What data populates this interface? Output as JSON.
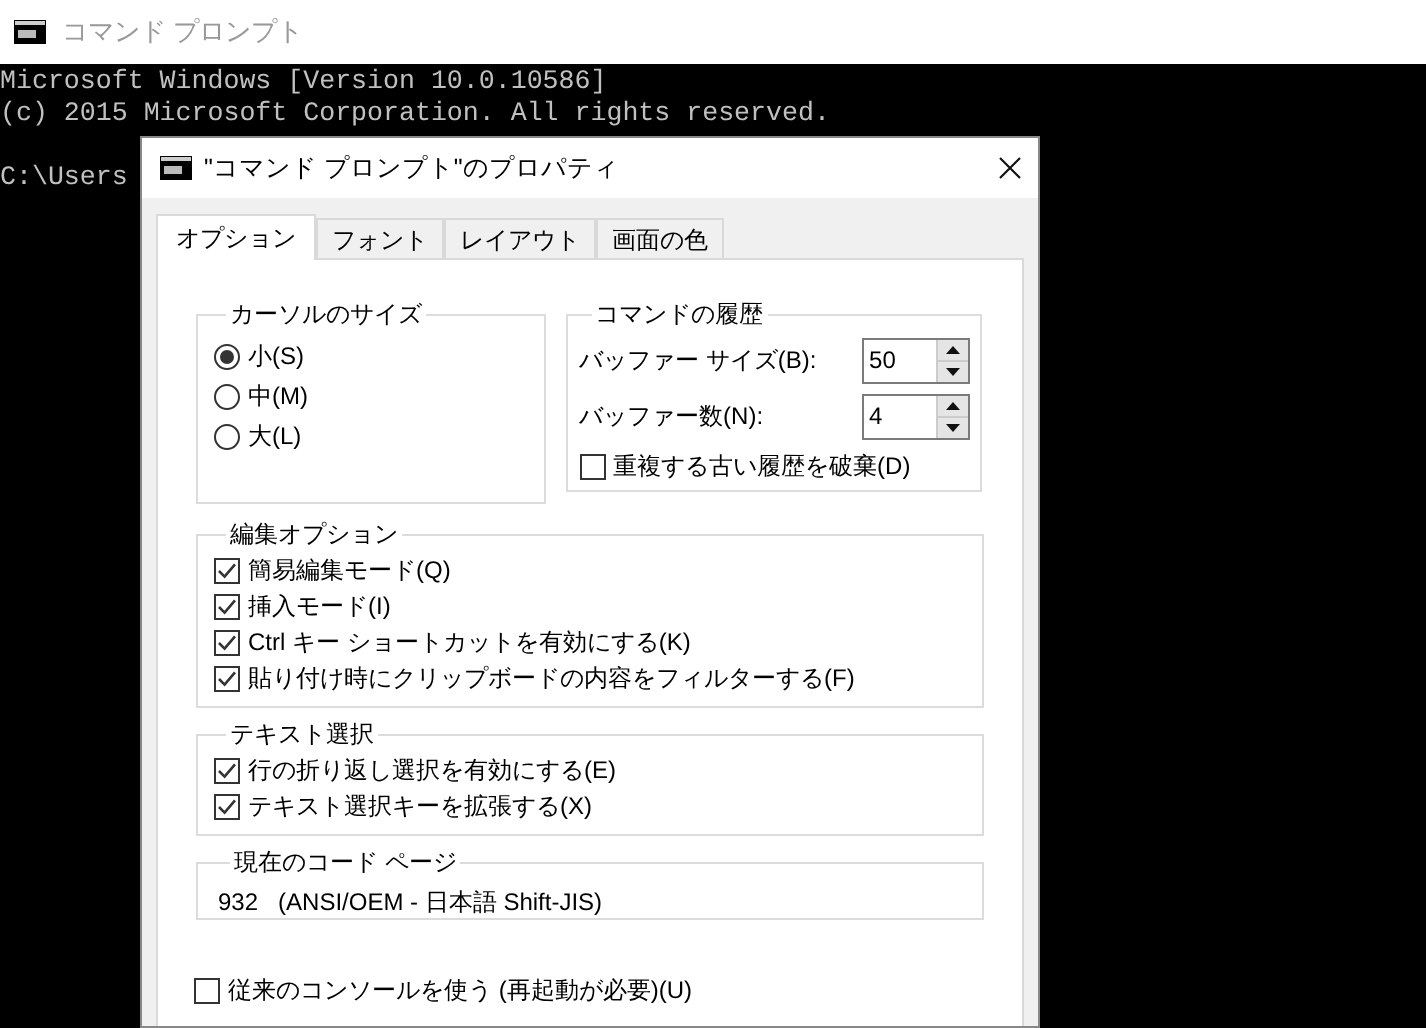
{
  "console": {
    "title": "コマンド プロンプト",
    "lines": [
      "Microsoft Windows [Version 10.0.10586]",
      "(c) 2015 Microsoft Corporation. All rights reserved."
    ],
    "prompt": "C:\\Users"
  },
  "dialog": {
    "title": "\"コマンド プロンプト\"のプロパティ",
    "tabs": [
      {
        "label": "オプション",
        "selected": true
      },
      {
        "label": "フォント",
        "selected": false
      },
      {
        "label": "レイアウト",
        "selected": false
      },
      {
        "label": "画面の色",
        "selected": false
      }
    ],
    "cursor_size": {
      "label": "カーソルのサイズ",
      "options": [
        {
          "label": "小(S)",
          "selected": true
        },
        {
          "label": "中(M)",
          "selected": false
        },
        {
          "label": "大(L)",
          "selected": false
        }
      ]
    },
    "command_history": {
      "label": "コマンドの履歴",
      "buffer_size": {
        "label": "バッファー サイズ(B):",
        "value": "50"
      },
      "buffer_count": {
        "label": "バッファー数(N):",
        "value": "4"
      },
      "discard_duplicates": {
        "label": "重複する古い履歴を破棄(D)",
        "checked": false
      }
    },
    "edit_options": {
      "label": "編集オプション",
      "items": [
        {
          "label": "簡易編集モード(Q)",
          "checked": true
        },
        {
          "label": "挿入モード(I)",
          "checked": true
        },
        {
          "label": "Ctrl キー ショートカットを有効にする(K)",
          "checked": true
        },
        {
          "label": "貼り付け時にクリップボードの内容をフィルターする(F)",
          "checked": true
        }
      ]
    },
    "text_selection": {
      "label": "テキスト選択",
      "items": [
        {
          "label": "行の折り返し選択を有効にする(E)",
          "checked": true
        },
        {
          "label": "テキスト選択キーを拡張する(X)",
          "checked": true
        }
      ]
    },
    "code_page": {
      "label": "現在のコード ページ",
      "value": "932   (ANSI/OEM - 日本語 Shift-JIS)"
    },
    "legacy_console": {
      "label": "従来のコンソールを使う (再起動が必要)(U)",
      "checked": false
    }
  }
}
